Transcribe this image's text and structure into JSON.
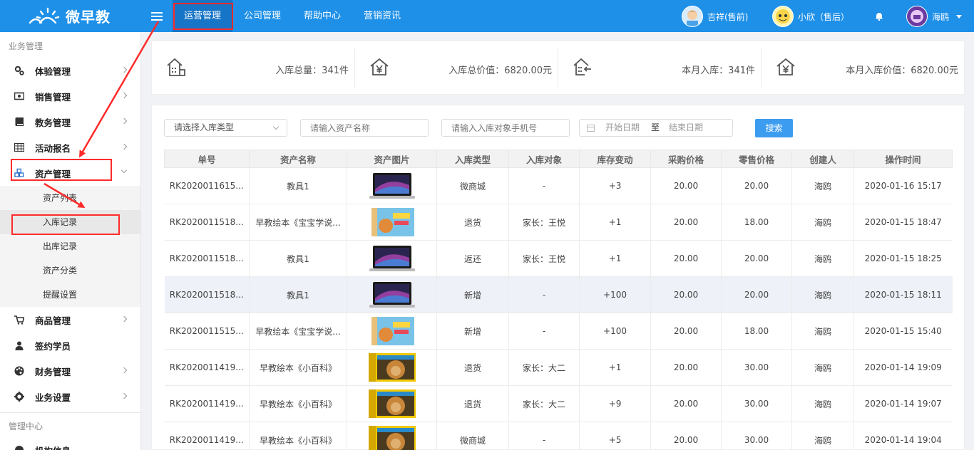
{
  "app": {
    "logo_text": "微早教"
  },
  "topnav": [
    "运营管理",
    "公司管理",
    "帮助中心",
    "营销资讯"
  ],
  "users": [
    {
      "name": "吉祥(售前)"
    },
    {
      "name": "小欣（售后）"
    },
    {
      "name": "海鸥"
    }
  ],
  "sidebar": {
    "section1": "业务管理",
    "items": [
      {
        "label": "体验管理",
        "icon": "gears-icon"
      },
      {
        "label": "销售管理",
        "icon": "money-icon"
      },
      {
        "label": "教务管理",
        "icon": "book-icon"
      },
      {
        "label": "活动报名",
        "icon": "table-icon"
      },
      {
        "label": "资产管理",
        "icon": "cubes-icon"
      }
    ],
    "sub": [
      "资产列表",
      "入库记录",
      "出库记录",
      "资产分类",
      "提醒设置"
    ],
    "items2": [
      {
        "label": "商品管理",
        "icon": "cart-icon"
      },
      {
        "label": "签约学员",
        "icon": "user-icon"
      },
      {
        "label": "财务管理",
        "icon": "palette-icon"
      },
      {
        "label": "业务设置",
        "icon": "gear-icon"
      }
    ],
    "section2": "管理中心",
    "items3": [
      {
        "label": "机构信息",
        "icon": "building-icon"
      }
    ]
  },
  "stats": [
    {
      "text": "入库总量：341件",
      "icon": "building-icon"
    },
    {
      "text": "入库总价值：6820.00元",
      "icon": "yen-house-icon"
    },
    {
      "text": "本月入库：341件",
      "icon": "house-in-icon"
    },
    {
      "text": "本月入库价值：6820.00元",
      "icon": "yen-house-icon"
    }
  ],
  "filters": {
    "type_select": "请选择入库类型",
    "asset_placeholder": "请输入资产名称",
    "phone_placeholder": "请输入入库对象手机号",
    "start_date": "开始日期",
    "date_sep": "至",
    "end_date": "结束日期",
    "search_label": "搜索"
  },
  "table": {
    "headers": [
      "单号",
      "资产名称",
      "资产图片",
      "入库类型",
      "入库对象",
      "库存变动",
      "采购价格",
      "零售价格",
      "创建人",
      "操作时间"
    ],
    "rows": [
      {
        "no": "RK2020011615...",
        "name": "教具1",
        "img": "laptop",
        "type": "微商城",
        "target": "-",
        "change": "+3",
        "buy": "20.00",
        "sell": "20.00",
        "creator": "海鸥",
        "time": "2020-01-16 15:17"
      },
      {
        "no": "RK2020011518...",
        "name": "早教绘本《宝宝学说...",
        "img": "picturebook",
        "type": "退货",
        "target": "家长：王悦",
        "change": "+1",
        "buy": "20.00",
        "sell": "18.00",
        "creator": "海鸥",
        "time": "2020-01-15 18:47"
      },
      {
        "no": "RK2020011518...",
        "name": "教具1",
        "img": "laptop",
        "type": "返还",
        "target": "家长：王悦",
        "change": "+1",
        "buy": "20.00",
        "sell": "20.00",
        "creator": "海鸥",
        "time": "2020-01-15 18:25"
      },
      {
        "no": "RK2020011518...",
        "name": "教具1",
        "img": "laptop",
        "type": "新增",
        "target": "-",
        "change": "+100",
        "buy": "20.00",
        "sell": "20.00",
        "creator": "海鸥",
        "time": "2020-01-15 18:11"
      },
      {
        "no": "RK2020011515...",
        "name": "早教绘本《宝宝学说...",
        "img": "picturebook",
        "type": "新增",
        "target": "-",
        "change": "+100",
        "buy": "20.00",
        "sell": "18.00",
        "creator": "海鸥",
        "time": "2020-01-15 15:40"
      },
      {
        "no": "RK2020011419...",
        "name": "早教绘本《小百科》",
        "img": "encyclopedia",
        "type": "退货",
        "target": "家长：大二",
        "change": "+1",
        "buy": "20.00",
        "sell": "30.00",
        "creator": "海鸥",
        "time": "2020-01-14 19:09"
      },
      {
        "no": "RK2020011419...",
        "name": "早教绘本《小百科》",
        "img": "encyclopedia",
        "type": "退货",
        "target": "家长：大二",
        "change": "+9",
        "buy": "20.00",
        "sell": "30.00",
        "creator": "海鸥",
        "time": "2020-01-14 19:07"
      },
      {
        "no": "RK2020011419...",
        "name": "早教绘本《小百科》",
        "img": "encyclopedia",
        "type": "微商城",
        "target": "-",
        "change": "+5",
        "buy": "20.00",
        "sell": "30.00",
        "creator": "海鸥",
        "time": "2020-01-14 19:04"
      }
    ]
  },
  "colors": {
    "primary": "#1e90e8",
    "annotation": "#ff2b2b",
    "search_button": "#3c9cf0"
  }
}
